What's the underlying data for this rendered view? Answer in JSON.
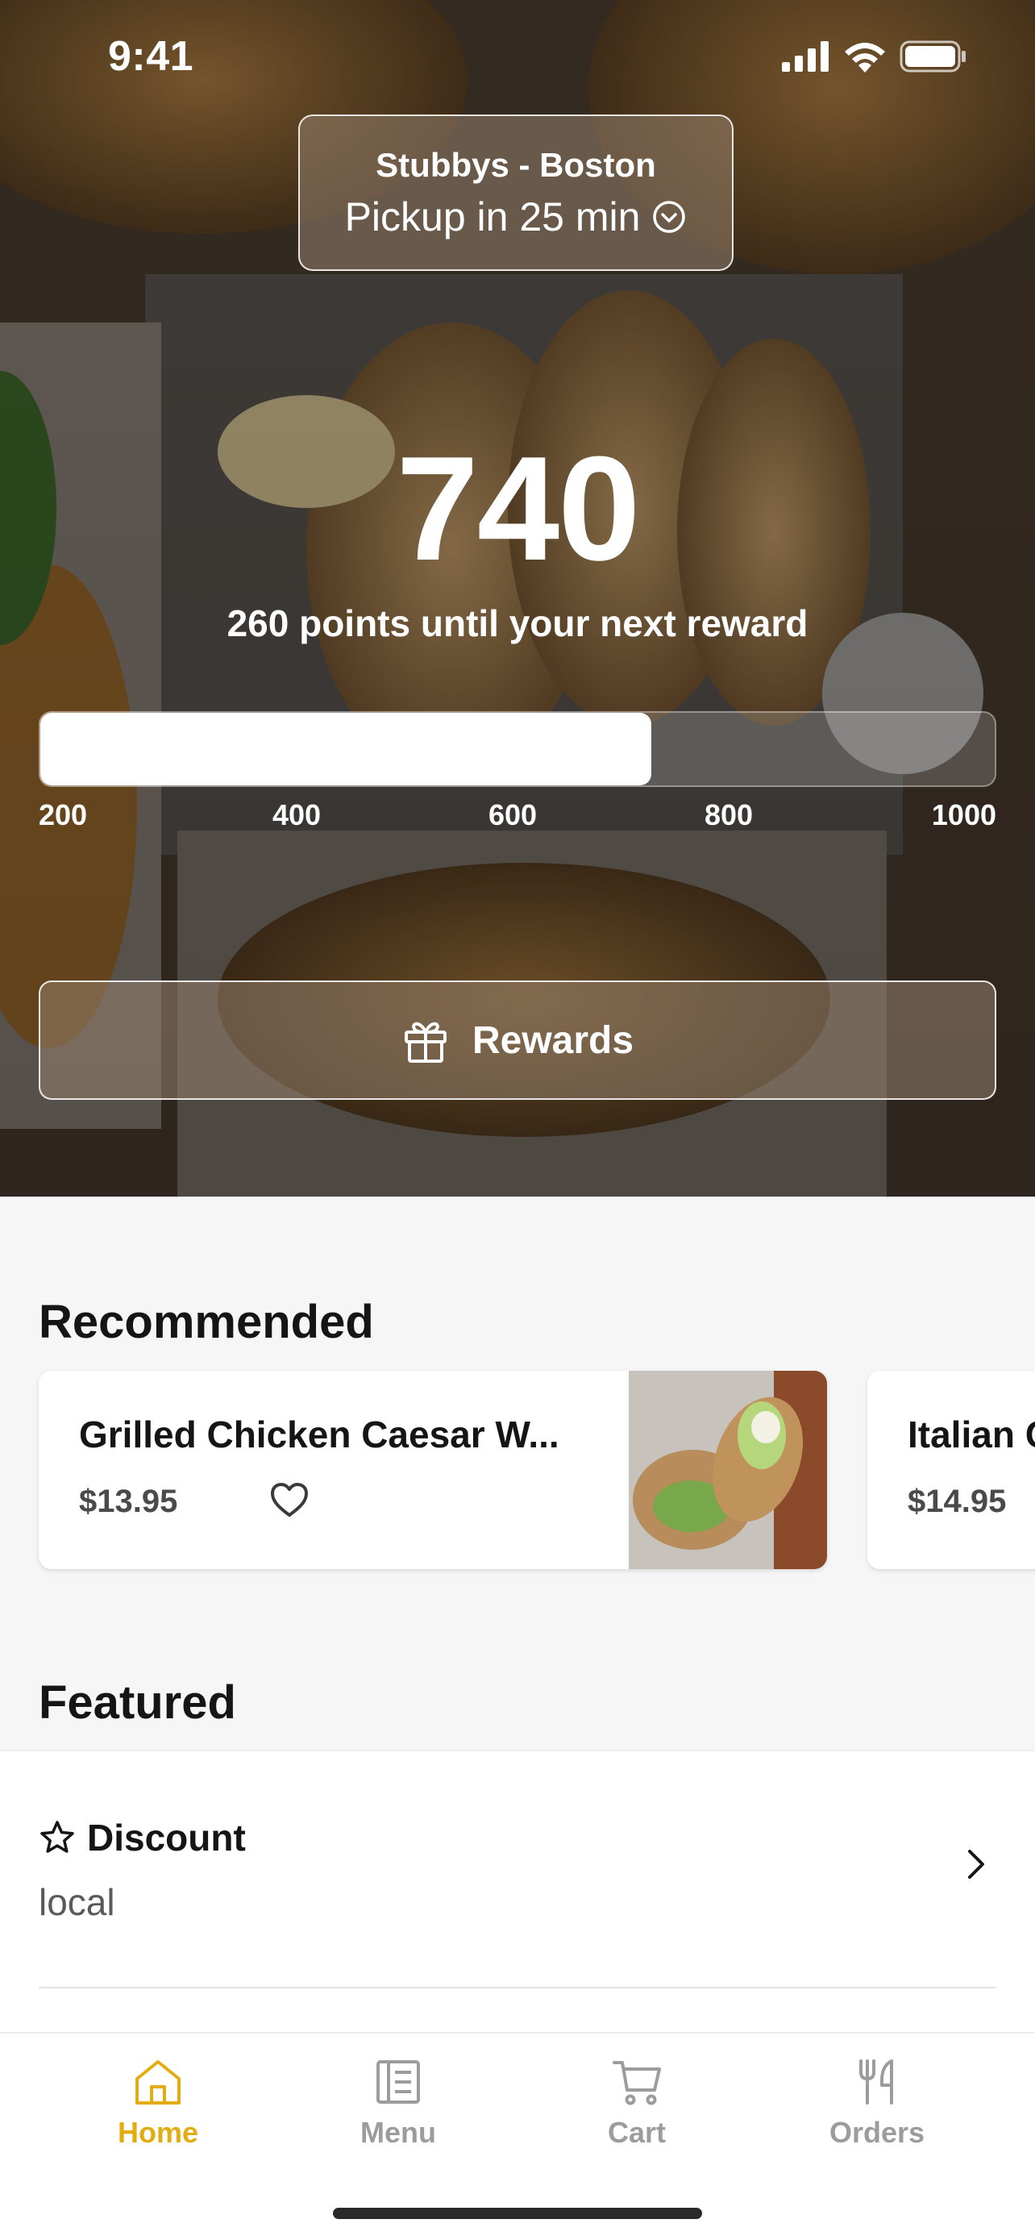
{
  "status_bar": {
    "time": "9:41"
  },
  "location": {
    "store_name": "Stubbys - Boston",
    "pickup_eta": "Pickup in 25 min"
  },
  "rewards": {
    "points": "740",
    "caption": "260 points until your next reward",
    "progress_fraction": 0.64,
    "ticks": [
      "200",
      "400",
      "600",
      "800",
      "1000"
    ],
    "button_label": "Rewards"
  },
  "recommended": {
    "title": "Recommended",
    "items": [
      {
        "name": "Grilled Chicken Caesar W...",
        "price": "$13.95"
      },
      {
        "name": "Italian C",
        "price": "$14.95"
      }
    ]
  },
  "featured": {
    "title": "Featured",
    "items": [
      {
        "title": "Discount",
        "subtitle": "local"
      }
    ]
  },
  "tab_bar": {
    "tabs": [
      {
        "label": "Home",
        "icon": "home-icon",
        "active": true
      },
      {
        "label": "Menu",
        "icon": "menu-icon",
        "active": false
      },
      {
        "label": "Cart",
        "icon": "cart-icon",
        "active": false
      },
      {
        "label": "Orders",
        "icon": "fork-knife-icon",
        "active": false
      }
    ]
  },
  "colors": {
    "accent": "#e2ad12",
    "inactive_tab": "#9c9c9c",
    "background": "#f6f6f6"
  }
}
